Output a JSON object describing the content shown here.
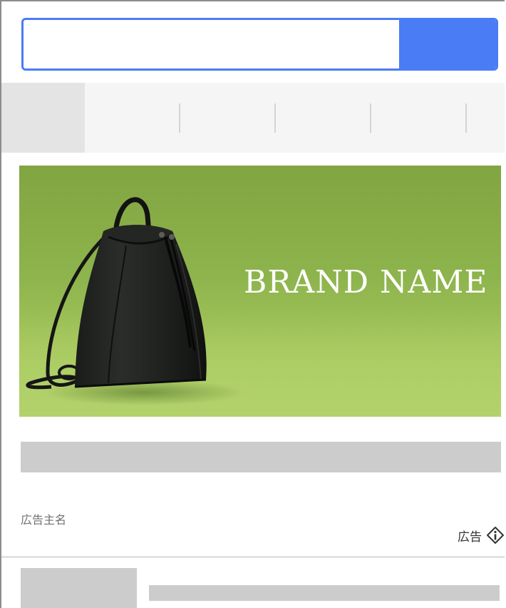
{
  "search": {
    "placeholder": "",
    "value": "",
    "button_label": ""
  },
  "tabs": [
    {
      "label": "",
      "active": true
    },
    {
      "label": ""
    },
    {
      "label": ""
    },
    {
      "label": ""
    },
    {
      "label": ""
    },
    {
      "label": ""
    }
  ],
  "ad": {
    "brand_name": "BRAND NAME",
    "image_subject": "black leather drawstring backpack",
    "advertiser": "広告主名",
    "ad_label": "広告",
    "info_icon": "info-icon"
  },
  "colors": {
    "accent": "#4a7cf6",
    "banner_green": "#8eb44d",
    "placeholder_gray": "#cccccc"
  }
}
